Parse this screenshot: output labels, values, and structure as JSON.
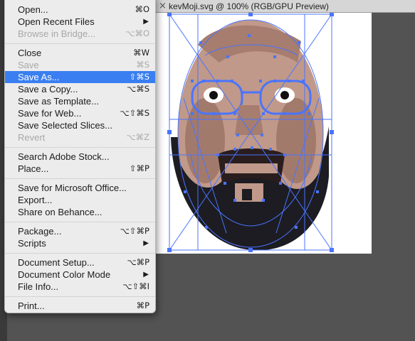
{
  "document": {
    "tab_title": "kevMoji.svg @ 100% (RGB/GPU Preview)",
    "close_glyph": "×"
  },
  "colors": {
    "menu_bg": "#ececec",
    "highlight": "#3a7ff1",
    "disabled_text": "#a8a8a8",
    "canvas_bg": "#535353",
    "selection": "#4a74ff",
    "face_skin": "#c0998a",
    "beard": "#1c1c22"
  },
  "menu": {
    "items": [
      {
        "label": "Open...",
        "shortcut": "⌘O"
      },
      {
        "label": "Open Recent Files",
        "submenu": "▶"
      },
      {
        "label": "Browse in Bridge...",
        "shortcut": "⌥⌘O",
        "disabled": true
      },
      {
        "label": "Close",
        "shortcut": "⌘W"
      },
      {
        "label": "Save",
        "shortcut": "⌘S",
        "disabled": true
      },
      {
        "label": "Save As...",
        "shortcut": "⇧⌘S",
        "highlighted": true
      },
      {
        "label": "Save a Copy...",
        "shortcut": "⌥⌘S"
      },
      {
        "label": "Save as Template..."
      },
      {
        "label": "Save for Web...",
        "shortcut": "⌥⇧⌘S"
      },
      {
        "label": "Save Selected Slices..."
      },
      {
        "label": "Revert",
        "shortcut": "⌥⌘Z",
        "disabled": true
      },
      {
        "label": "Search Adobe Stock..."
      },
      {
        "label": "Place...",
        "shortcut": "⇧⌘P"
      },
      {
        "label": "Save for Microsoft Office..."
      },
      {
        "label": "Export..."
      },
      {
        "label": "Share on Behance..."
      },
      {
        "label": "Package...",
        "shortcut": "⌥⇧⌘P"
      },
      {
        "label": "Scripts",
        "submenu": "▶"
      },
      {
        "label": "Document Setup...",
        "shortcut": "⌥⌘P"
      },
      {
        "label": "Document Color Mode",
        "submenu": "▶"
      },
      {
        "label": "File Info...",
        "shortcut": "⌥⇧⌘I"
      },
      {
        "label": "Print...",
        "shortcut": "⌘P"
      }
    ]
  }
}
